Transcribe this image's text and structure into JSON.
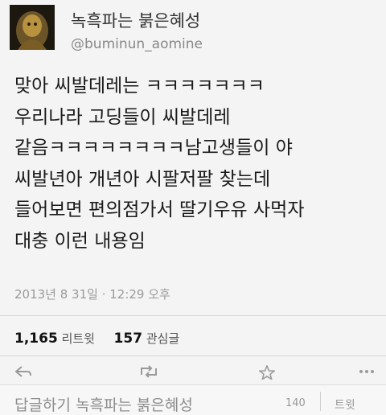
{
  "header": {
    "display_name": "녹흑파는 붉은혜성",
    "handle": "@buminun_aomine"
  },
  "tweet": {
    "lines": [
      "맞아 씨발데레는 ㅋㅋㅋㅋㅋㅋㅋ",
      "우리나라 고딩들이 씨발데레",
      "같음ㅋㅋㅋㅋㅋㅋㅋㅋ남고생들이 야",
      "씨발년아 개년아 시팔저팔 찾는데",
      "들어보면 편의점가서 딸기우유 사먹자",
      "대충 이런 내용임"
    ],
    "timestamp": "2013년 8 31일 · 12:29 오후"
  },
  "stats": {
    "retweets_count": "1,165",
    "retweets_label": "리트윗",
    "favorites_count": "157",
    "favorites_label": "관심글"
  },
  "actions": {
    "icons": [
      "reply-icon",
      "retweet-icon",
      "favorite-icon",
      "more-icon"
    ]
  },
  "reply_bar": {
    "placeholder": "답글하기 녹흑파는 붉은혜성",
    "char_count": "140",
    "tweet_label": "트윗"
  }
}
